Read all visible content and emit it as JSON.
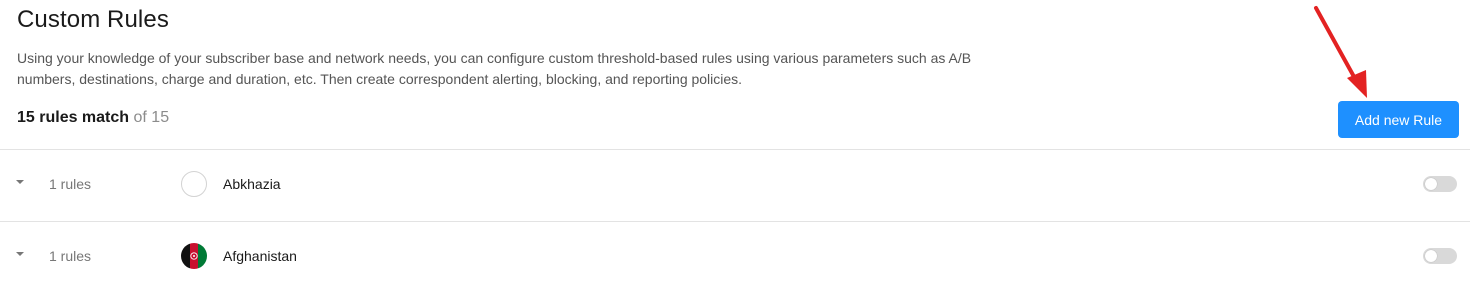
{
  "header": {
    "title": "Custom Rules",
    "description": "Using your knowledge of your subscriber base and network needs, you can configure custom threshold-based rules using various parameters such as A/B numbers, destinations, charge and duration, etc. Then create correspondent alerting, blocking, and reporting policies.",
    "match_count": "15 rules match",
    "match_total": "of 15",
    "add_button_label": "Add new Rule"
  },
  "colors": {
    "accent": "#1e90ff",
    "annotation_arrow": "#e32222",
    "toggle_off": "#d9d9d9"
  },
  "rows": [
    {
      "rules_label": "1 rules",
      "country": "Abkhazia",
      "flag": "empty-flag-icon",
      "enabled": false
    },
    {
      "rules_label": "1 rules",
      "country": "Afghanistan",
      "flag": "afghanistan-flag-icon",
      "enabled": false
    }
  ]
}
